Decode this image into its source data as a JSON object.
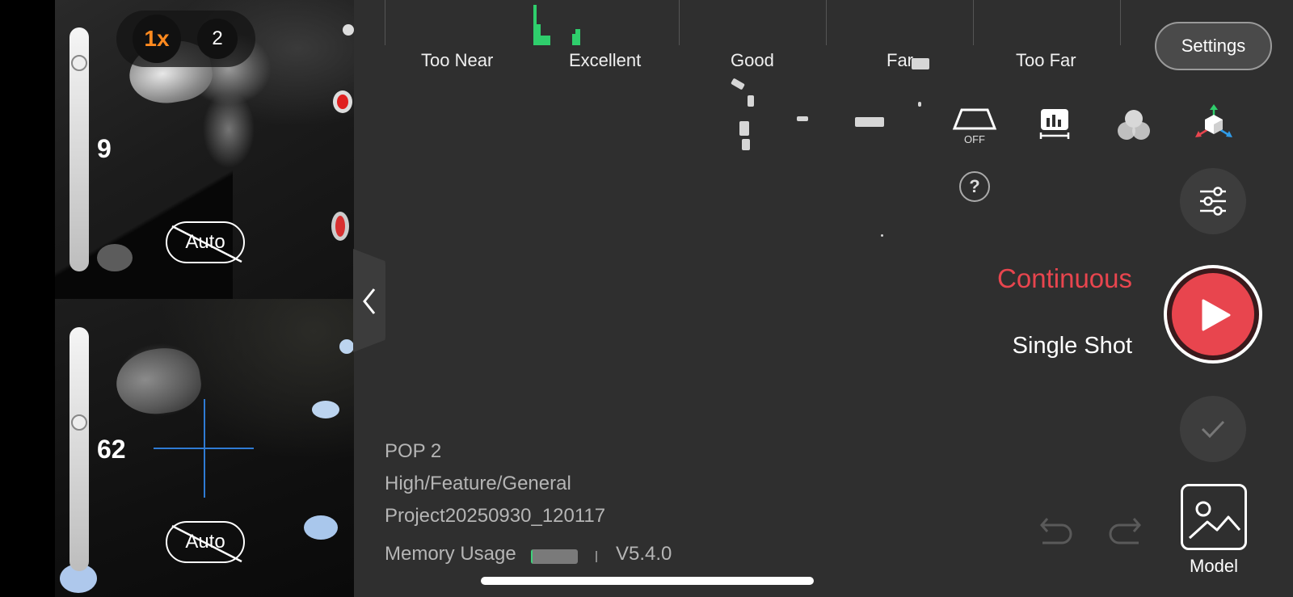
{
  "camera": {
    "zoom_options": [
      "1x",
      "2"
    ],
    "top_preview": {
      "exposure_value": "9",
      "auto_label": "Auto"
    },
    "bottom_preview": {
      "exposure_value": "62",
      "auto_label": "Auto"
    }
  },
  "distance_indicator": {
    "labels": [
      "Too Near",
      "Excellent",
      "Good",
      "Far",
      "Too Far"
    ]
  },
  "header": {
    "settings_label": "Settings"
  },
  "toolbar": {
    "icons": [
      "projector-icon",
      "histogram-icon",
      "color-icon",
      "axis-cube-icon"
    ],
    "off_label": "OFF",
    "help_label": "?"
  },
  "modes": {
    "continuous": "Continuous",
    "single": "Single Shot"
  },
  "colors": {
    "accent": "#e8454e",
    "histogram": "#2fce6c",
    "crosshair": "#2f7bd4",
    "zoom_active": "#ff8a1f"
  },
  "info": {
    "device": "POP 2",
    "scan_mode": "High/Feature/General",
    "project": "Project20250930_120117",
    "memory_label": "Memory Usage",
    "memory_fraction": 0.04,
    "version": "V5.4.0"
  },
  "model": {
    "label": "Model"
  }
}
